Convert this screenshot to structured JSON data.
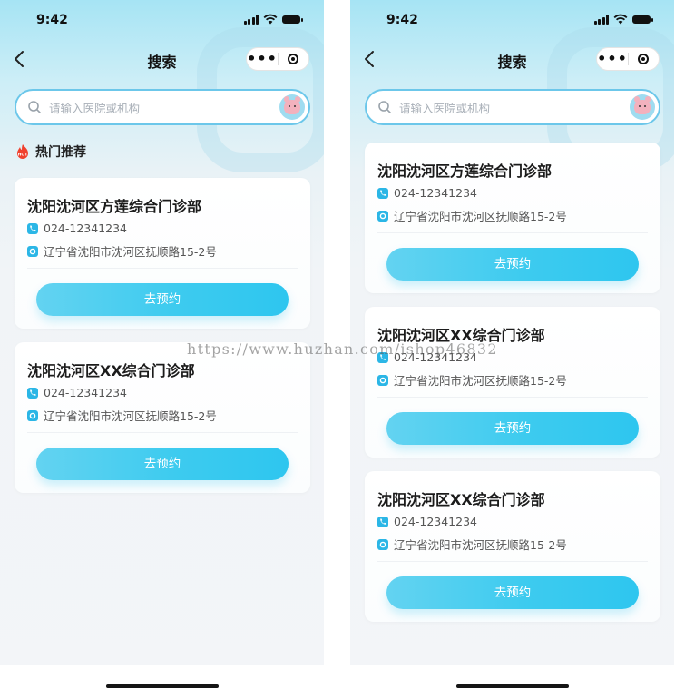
{
  "status": {
    "time": "9:42"
  },
  "nav": {
    "title": "搜索",
    "more_label": "•••"
  },
  "search": {
    "placeholder": "请输入医院或机构"
  },
  "hot": {
    "label": "热门推荐",
    "badge": "HOT"
  },
  "colors": {
    "accent": "#3dcbef",
    "search_border": "#6cc7ea",
    "icon": "#2bb6e6"
  },
  "left_cards": [
    {
      "title": "沈阳沈河区方莲综合门诊部",
      "phone": "024-12341234",
      "address": "辽宁省沈阳市沈河区抚顺路15-2号",
      "button": "去预约"
    },
    {
      "title": "沈阳沈河区XX综合门诊部",
      "phone": "024-12341234",
      "address": "辽宁省沈阳市沈河区抚顺路15-2号",
      "button": "去预约"
    }
  ],
  "right_cards": [
    {
      "title": "沈阳沈河区方莲综合门诊部",
      "phone": "024-12341234",
      "address": "辽宁省沈阳市沈河区抚顺路15-2号",
      "button": "去预约"
    },
    {
      "title": "沈阳沈河区XX综合门诊部",
      "phone": "024-12341234",
      "address": "辽宁省沈阳市沈河区抚顺路15-2号",
      "button": "去预约"
    },
    {
      "title": "沈阳沈河区XX综合门诊部",
      "phone": "024-12341234",
      "address": "辽宁省沈阳市沈河区抚顺路15-2号",
      "button": "去预约"
    }
  ],
  "watermark": "https://www.huzhan.com/ishop46832"
}
